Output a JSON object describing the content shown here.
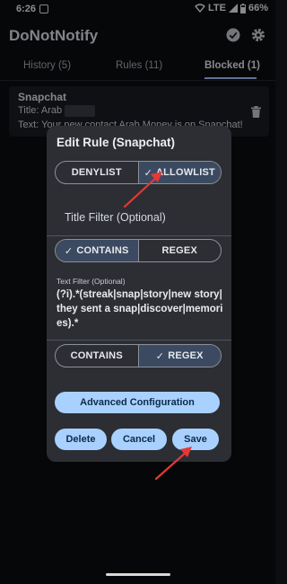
{
  "status_bar": {
    "time": "6:26",
    "network": "LTE",
    "battery": "66%"
  },
  "app": {
    "title": "DoNotNotify"
  },
  "tabs": [
    {
      "label": "History (5)"
    },
    {
      "label": "Rules (11)"
    },
    {
      "label": "Blocked (1)"
    }
  ],
  "list_item": {
    "app_name": "Snapchat",
    "title_line": "Title: Arab",
    "text_line": "Text: Your new contact Arab Money is on Snapchat!"
  },
  "dialog": {
    "title": "Edit Rule (Snapchat)",
    "mode": {
      "options": [
        "DENYLIST",
        "ALLOWLIST"
      ],
      "selected": "ALLOWLIST"
    },
    "title_filter_label": "Title Filter (Optional)",
    "title_match": {
      "options": [
        "CONTAINS",
        "REGEX"
      ],
      "selected": "CONTAINS"
    },
    "text_filter_label": "Text Filter (Optional)",
    "text_filter_value": "(?i).*(streak|snap|story|new story|they sent a snap|discover|memories).*",
    "text_match": {
      "options": [
        "CONTAINS",
        "REGEX"
      ],
      "selected": "REGEX"
    },
    "advanced_button": "Advanced Configuration",
    "delete_button": "Delete",
    "cancel_button": "Cancel",
    "save_button": "Save"
  },
  "colors": {
    "background": "#0c0d10",
    "dialog": "#2c2e34",
    "accent_button": "#a9d1ff",
    "selected_segment": "#3b4a60",
    "annotation_arrow": "#e53935"
  },
  "icons": [
    "notification-icon",
    "wifi-icon",
    "signal-icon",
    "battery-icon",
    "check-circle-icon",
    "gear-icon",
    "trash-icon",
    "check-icon"
  ]
}
